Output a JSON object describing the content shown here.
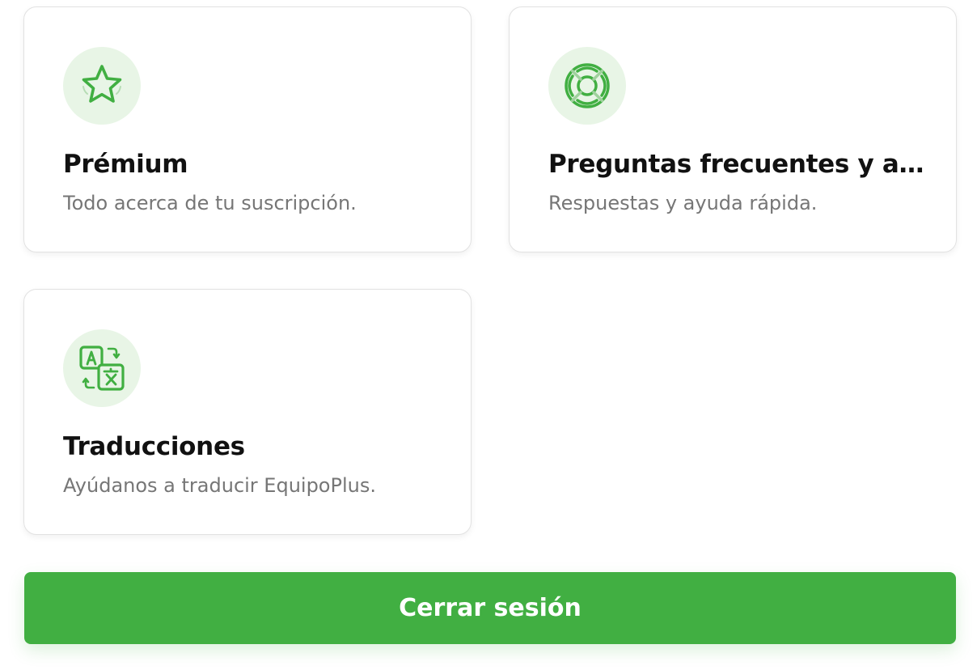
{
  "cards": [
    {
      "title": "Prémium",
      "subtitle": "Todo acerca de tu suscripción.",
      "icon": "star-icon"
    },
    {
      "title": "Preguntas frecuentes y asistencia",
      "subtitle": "Respuestas y ayuda rápida.",
      "icon": "lifebuoy-icon"
    },
    {
      "title": "Traducciones",
      "subtitle": "Ayúdanos a traducir EquipoPlus.",
      "icon": "translate-icon"
    }
  ],
  "logout_label": "Cerrar sesión",
  "colors": {
    "accent": "#41af42",
    "icon_bg": "#e8f5e6",
    "title": "#111111",
    "subtitle": "#767676",
    "card_border": "#e2e2e2"
  }
}
